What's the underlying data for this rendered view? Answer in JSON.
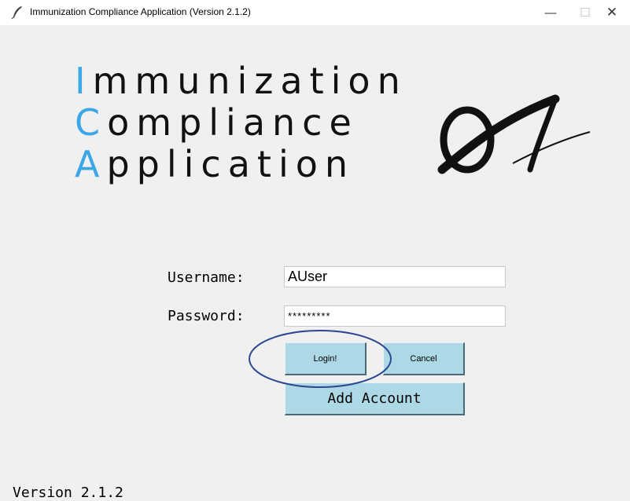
{
  "window": {
    "title": "Immunization Compliance Application (Version 2.1.2)",
    "icon": "feather-icon",
    "controls": {
      "minimize": "—",
      "maximize": "☐",
      "close": "✕"
    }
  },
  "logo": {
    "line1": {
      "initial": "I",
      "rest": "mmunization"
    },
    "line2": {
      "initial": "C",
      "rest": "ompliance"
    },
    "line3": {
      "initial": "A",
      "rest": "pplication"
    },
    "mark": "stylized-ica-monogram",
    "accent_color": "#3ba7e6"
  },
  "form": {
    "username_label": "Username:",
    "username_value": "AUser",
    "password_label": "Password:",
    "password_value": "*********"
  },
  "buttons": {
    "login": "Login!",
    "cancel": "Cancel",
    "add_account": "Add Account",
    "color": "#add8e6"
  },
  "annotation": {
    "shape": "ellipse",
    "color": "#2e4a8f",
    "target": "login-button"
  },
  "footer": {
    "version": "Version 2.1.2"
  }
}
